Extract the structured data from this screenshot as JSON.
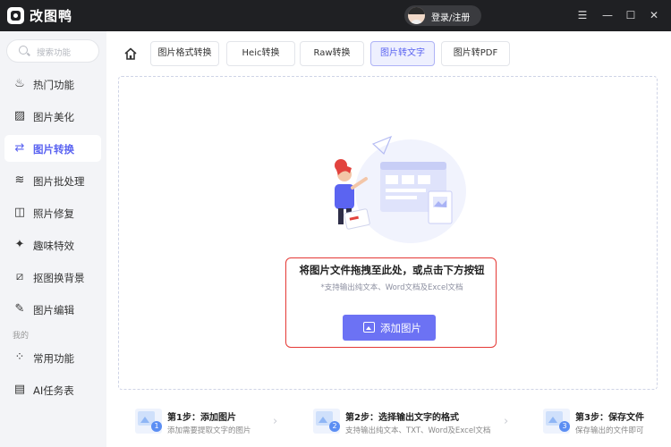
{
  "app": {
    "name": "改图鸭",
    "login_label": "登录/注册"
  },
  "window_controls": {
    "menu": "☰",
    "minimize": "—",
    "maximize": "☐",
    "close": "✕"
  },
  "sidebar": {
    "search_placeholder": "搜索功能",
    "items": [
      {
        "label": "热门功能",
        "icon": "flame-icon",
        "glyph": "♨"
      },
      {
        "label": "图片美化",
        "icon": "image-icon",
        "glyph": "▨"
      },
      {
        "label": "图片转换",
        "icon": "convert-icon",
        "glyph": "⇄",
        "active": true
      },
      {
        "label": "图片批处理",
        "icon": "layers-icon",
        "glyph": "≋"
      },
      {
        "label": "照片修复",
        "icon": "repair-icon",
        "glyph": "◫"
      },
      {
        "label": "趣味特效",
        "icon": "sparkle-icon",
        "glyph": "✦"
      },
      {
        "label": "抠图换背景",
        "icon": "cutout-icon",
        "glyph": "⧄"
      },
      {
        "label": "图片编辑",
        "icon": "edit-icon",
        "glyph": "✎"
      }
    ],
    "section_label": "我的",
    "my_items": [
      {
        "label": "常用功能",
        "icon": "grid-icon",
        "glyph": "⁘"
      },
      {
        "label": "AI任务表",
        "icon": "task-list-icon",
        "glyph": "▤"
      }
    ]
  },
  "tabs": [
    {
      "label": "图片格式转换"
    },
    {
      "label": "Heic转换"
    },
    {
      "label": "Raw转换"
    },
    {
      "label": "图片转文字",
      "active": true
    },
    {
      "label": "图片转PDF"
    }
  ],
  "dropzone": {
    "title": "将图片文件拖拽至此处，或点击下方按钮",
    "subtitle": "*支持输出纯文本、Word文档及Excel文档",
    "button_label": "添加图片"
  },
  "steps": [
    {
      "number": "1",
      "title": "第1步：添加图片",
      "desc": "添加需要提取文字的图片"
    },
    {
      "number": "2",
      "title": "第2步：选择输出文字的格式",
      "desc": "支持输出纯文本、TXT、Word及Excel文档"
    },
    {
      "number": "3",
      "title": "第3步：保存文件",
      "desc": "保存输出的文件即可"
    }
  ],
  "colors": {
    "accent": "#5b64f1",
    "button": "#6c72f4",
    "titlebar": "#1f2023",
    "highlight_frame": "#e53935"
  }
}
